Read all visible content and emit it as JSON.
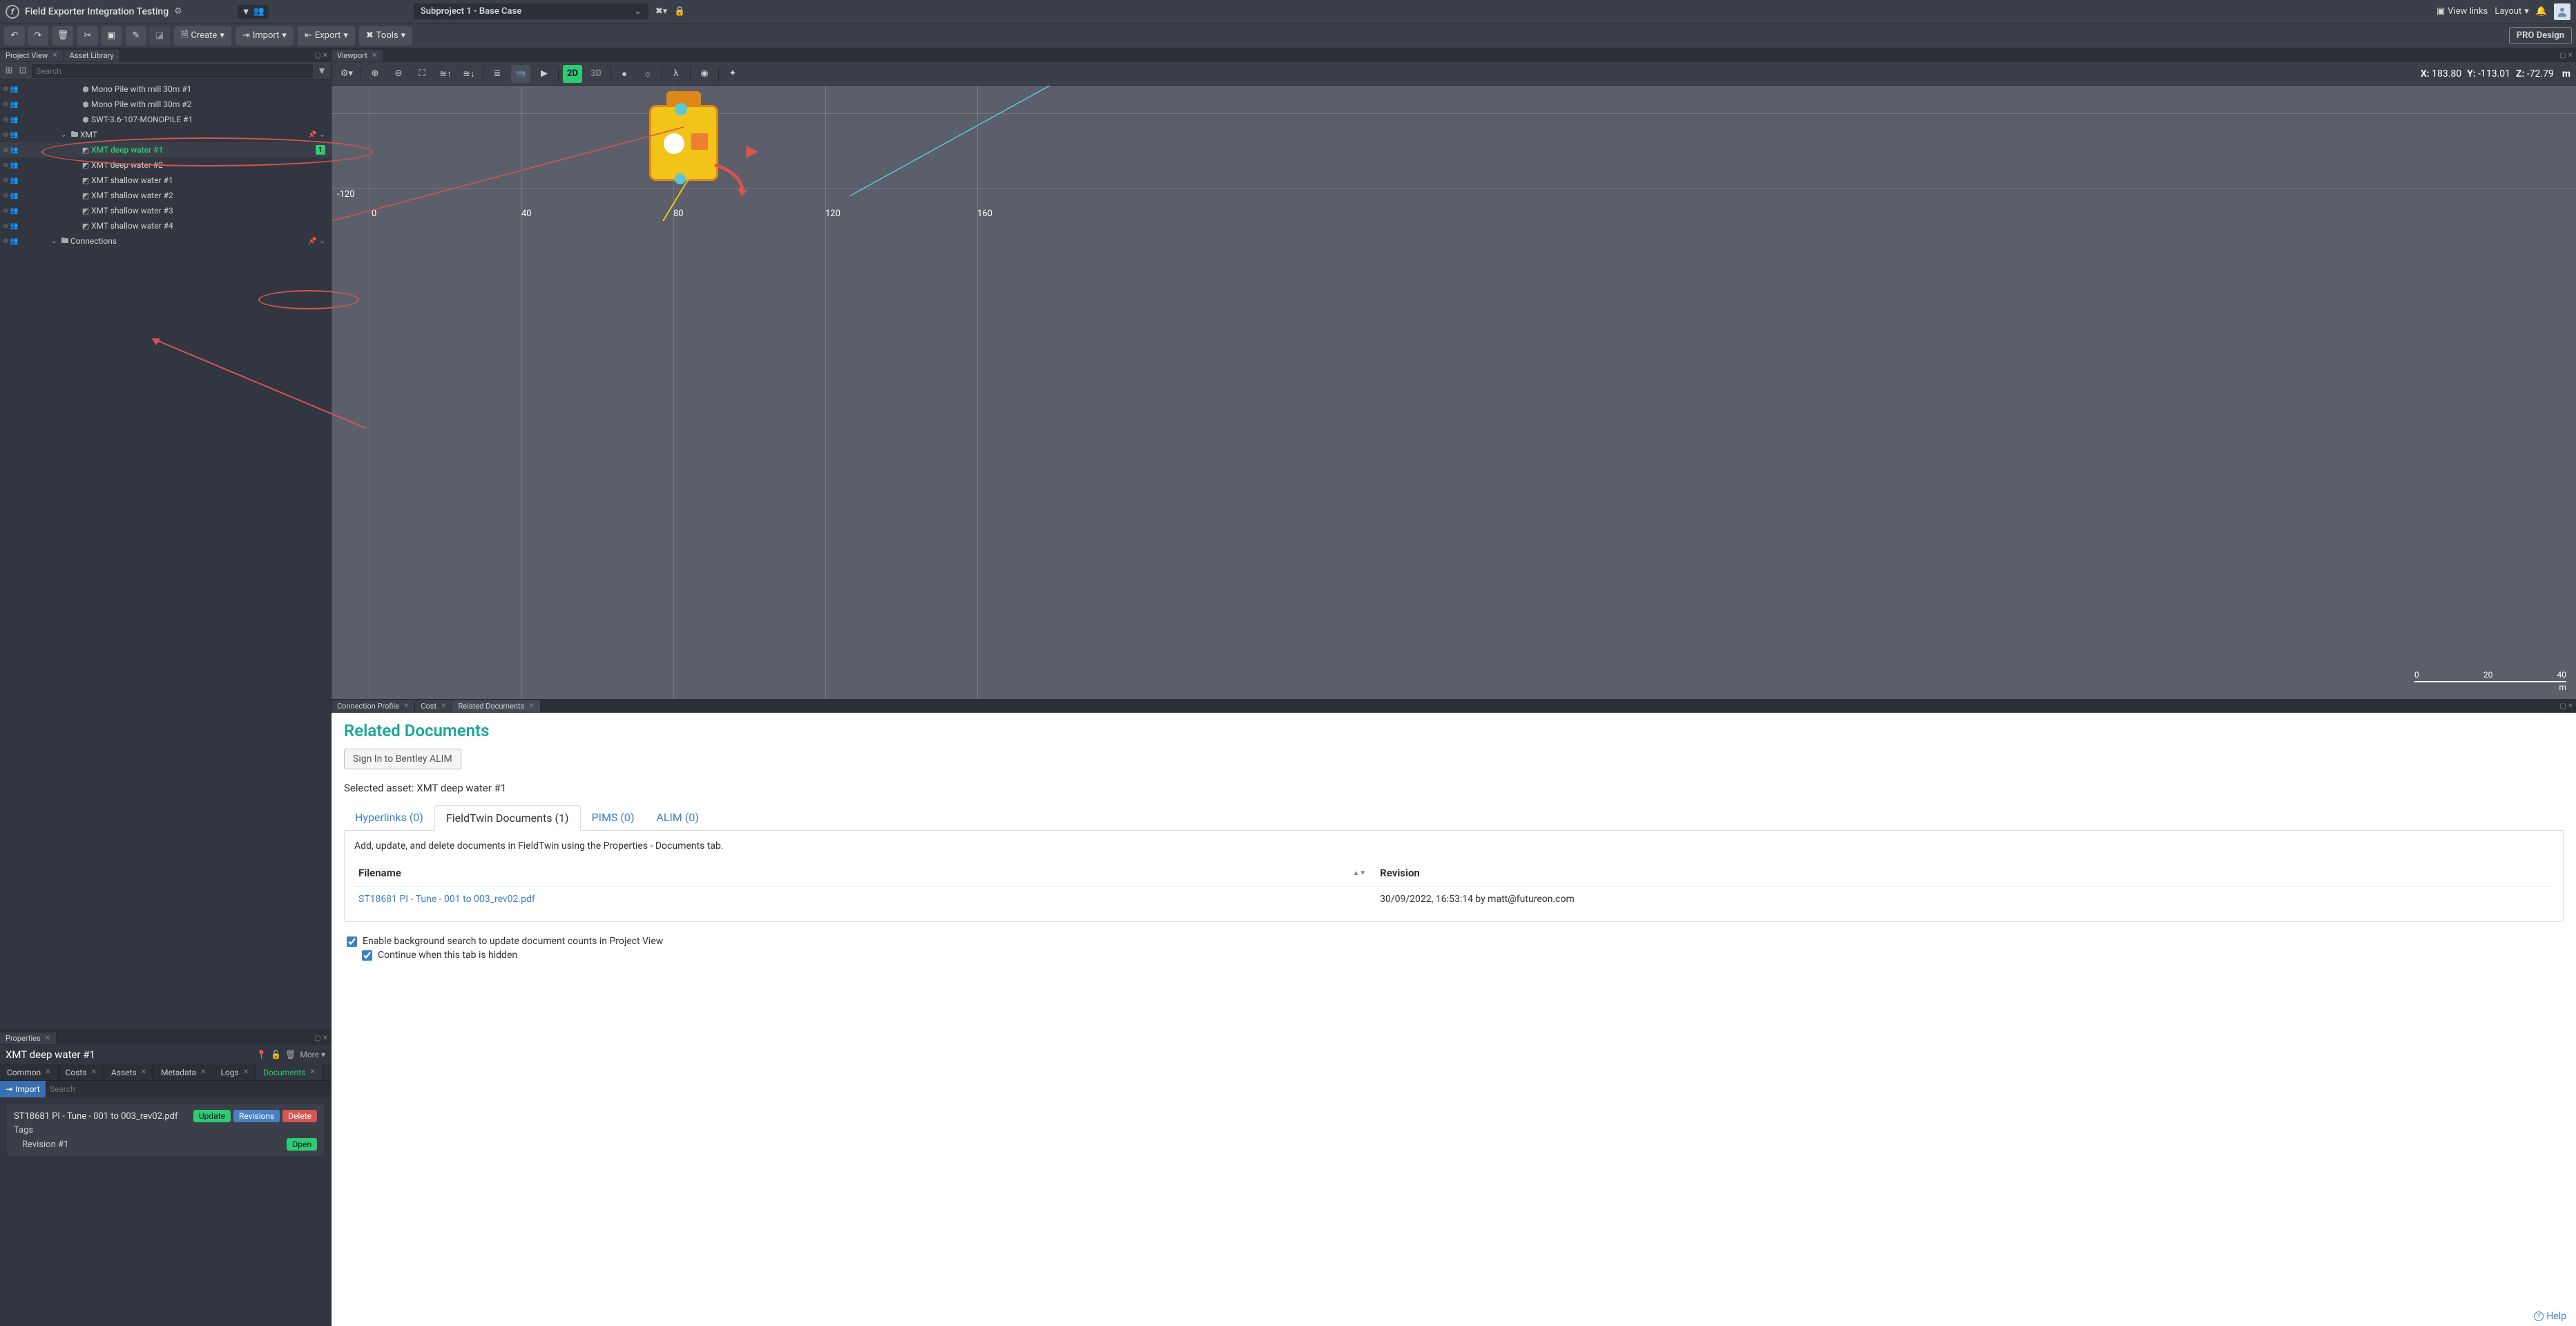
{
  "topbar": {
    "title": "Field Exporter Integration Testing",
    "subproject": "Subproject 1 - Base Case",
    "view_links": "View links",
    "layout": "Layout"
  },
  "toolbar": {
    "create": "Create",
    "import": "Import",
    "export": "Export",
    "tools": "Tools",
    "pro_design": "PRO Design"
  },
  "left_tabs": {
    "project_view": "Project View",
    "asset_library": "Asset Library"
  },
  "search": {
    "placeholder": "Search"
  },
  "tree": {
    "items": [
      {
        "label": "Mono Pile with mill 30m #1",
        "indent": 5,
        "icon": "cube"
      },
      {
        "label": "Mono Pile with mill 30m #2",
        "indent": 5,
        "icon": "cube"
      },
      {
        "label": "SWT-3.6-107-MONOPILE #1",
        "indent": 5,
        "icon": "cube"
      },
      {
        "label": "XMT",
        "indent": 3,
        "icon": "folder",
        "caret": "v",
        "right": "pin-caret"
      },
      {
        "label": "XMT deep water #1",
        "indent": 5,
        "icon": "layers",
        "selected": true,
        "badge": "1"
      },
      {
        "label": "XMT deep water #2",
        "indent": 5,
        "icon": "layers"
      },
      {
        "label": "XMT shallow water #1",
        "indent": 5,
        "icon": "layers"
      },
      {
        "label": "XMT shallow water #2",
        "indent": 5,
        "icon": "layers"
      },
      {
        "label": "XMT shallow water #3",
        "indent": 5,
        "icon": "layers"
      },
      {
        "label": "XMT shallow water #4",
        "indent": 5,
        "icon": "layers"
      },
      {
        "label": "Connections",
        "indent": 2,
        "icon": "folder",
        "caret": "v",
        "right": "pin-caret"
      }
    ]
  },
  "properties": {
    "panel_tab": "Properties",
    "title": "XMT deep water #1",
    "more": "More",
    "tabs": [
      "Common",
      "Costs",
      "Assets",
      "Metadata",
      "Logs",
      "Documents"
    ],
    "active_tab": "Documents",
    "import": "Import",
    "import_search_placeholder": "Search",
    "doc": {
      "filename": "ST18681 PI - Tune - 001 to 003_rev02.pdf",
      "update": "Update",
      "revisions": "Revisions",
      "delete": "Delete",
      "tags_label": "Tags",
      "revision": "Revision #1",
      "open": "Open"
    }
  },
  "viewport": {
    "tab": "Viewport",
    "mode_2d": "2D",
    "mode_3d": "3D",
    "coords": {
      "x_label": "X:",
      "x": "183.80",
      "y_label": "Y:",
      "y": "-113.01",
      "z_label": "Z:",
      "z": "-72.79",
      "unit": "m"
    },
    "axis_minus120": "-120",
    "axis_0": "0",
    "axis_40": "40",
    "axis_80": "80",
    "axis_120": "120",
    "axis_160": "160",
    "scale": {
      "s0": "0",
      "s20": "20",
      "s40": "40",
      "unit": "m"
    }
  },
  "bottom_tabs": {
    "connection_profile": "Connection Profile",
    "cost": "Cost",
    "related_documents": "Related Documents"
  },
  "related_docs": {
    "title": "Related Documents",
    "sign_in": "Sign In to Bentley ALIM",
    "selected_asset_label": "Selected asset: ",
    "selected_asset": "XMT deep water #1",
    "tabs": {
      "hyperlinks": "Hyperlinks (0)",
      "fieldtwin": "FieldTwin Documents (1)",
      "pims": "PIMS (0)",
      "alim": "ALIM (0)"
    },
    "help_text": "Add, update, and delete documents in FieldTwin using the Properties - Documents tab.",
    "col_filename": "Filename",
    "col_revision": "Revision",
    "row_filename": "ST18681 PI - Tune - 001 to 003_rev02.pdf",
    "row_revision": "30/09/2022, 16:53:14 by matt@futureon.com",
    "cb1": "Enable background search to update document counts in Project View",
    "cb2": "Continue when this tab is hidden",
    "help": "Help"
  }
}
